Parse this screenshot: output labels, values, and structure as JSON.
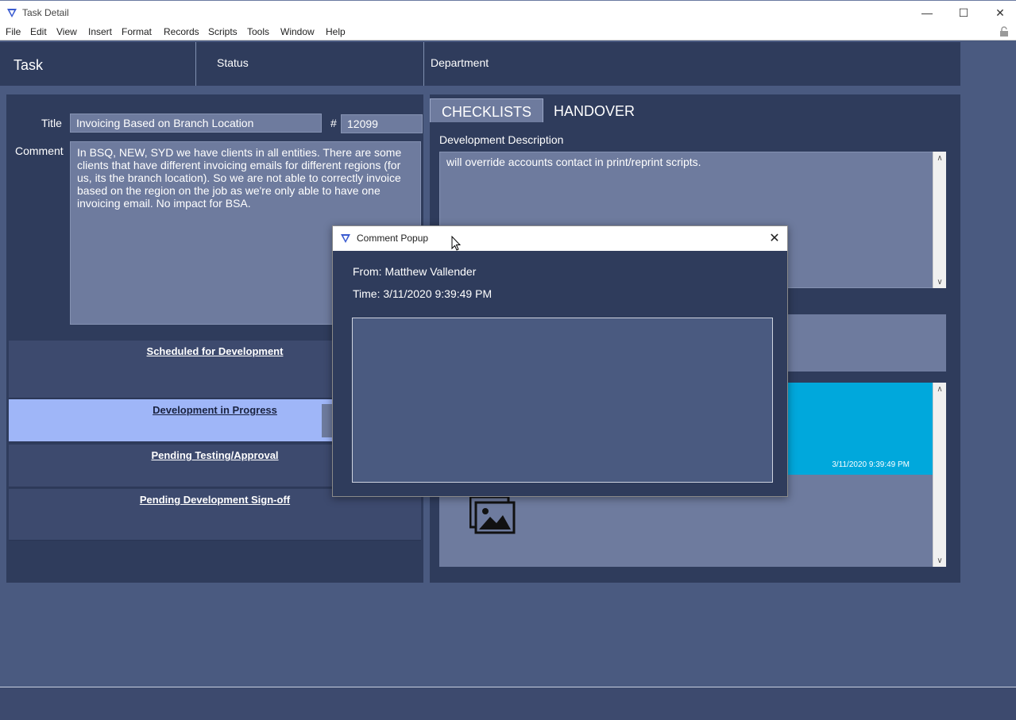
{
  "window": {
    "title": "Task Detail"
  },
  "menu": [
    "File",
    "Edit",
    "View",
    "Insert",
    "Format",
    "Records",
    "Scripts",
    "Tools",
    "Window",
    "Help"
  ],
  "header": {
    "task": "Task",
    "status": "Status",
    "department": "Department"
  },
  "form": {
    "title_label": "Title",
    "title_value": "Invoicing Based on Branch Location",
    "number_label": "#",
    "number_value": "12099",
    "comment_label": "Comment",
    "comment_value": "In BSQ, NEW, SYD we have clients in all entities. There are some clients that have different invoicing emails for different regions (for us, its the branch location). So we are not able to correctly invoice based on the region on the job as we're only able to have one invoicing email. No impact for BSA."
  },
  "stages": [
    {
      "label": "Scheduled for Development"
    },
    {
      "label": "Development in Progress"
    },
    {
      "label": "Pending Testing/Approval"
    },
    {
      "label": "Pending Development Sign-off"
    }
  ],
  "tabs": {
    "checklists": "CHECKLISTS",
    "handover": "HANDOVER"
  },
  "development": {
    "label": "Development Description",
    "value": "will override accounts contact in print/reprint scripts."
  },
  "message": {
    "timestamp": "3/11/2020 9:39:49 PM"
  },
  "popup": {
    "title": "Comment Popup",
    "from": "From: Matthew Vallender",
    "time": "Time: 3/11/2020 9:39:49 PM"
  },
  "icons": [
    "app-icon",
    "minimize-icon",
    "maximize-icon",
    "close-icon",
    "lock-icon",
    "image-icon",
    "cursor-icon"
  ]
}
